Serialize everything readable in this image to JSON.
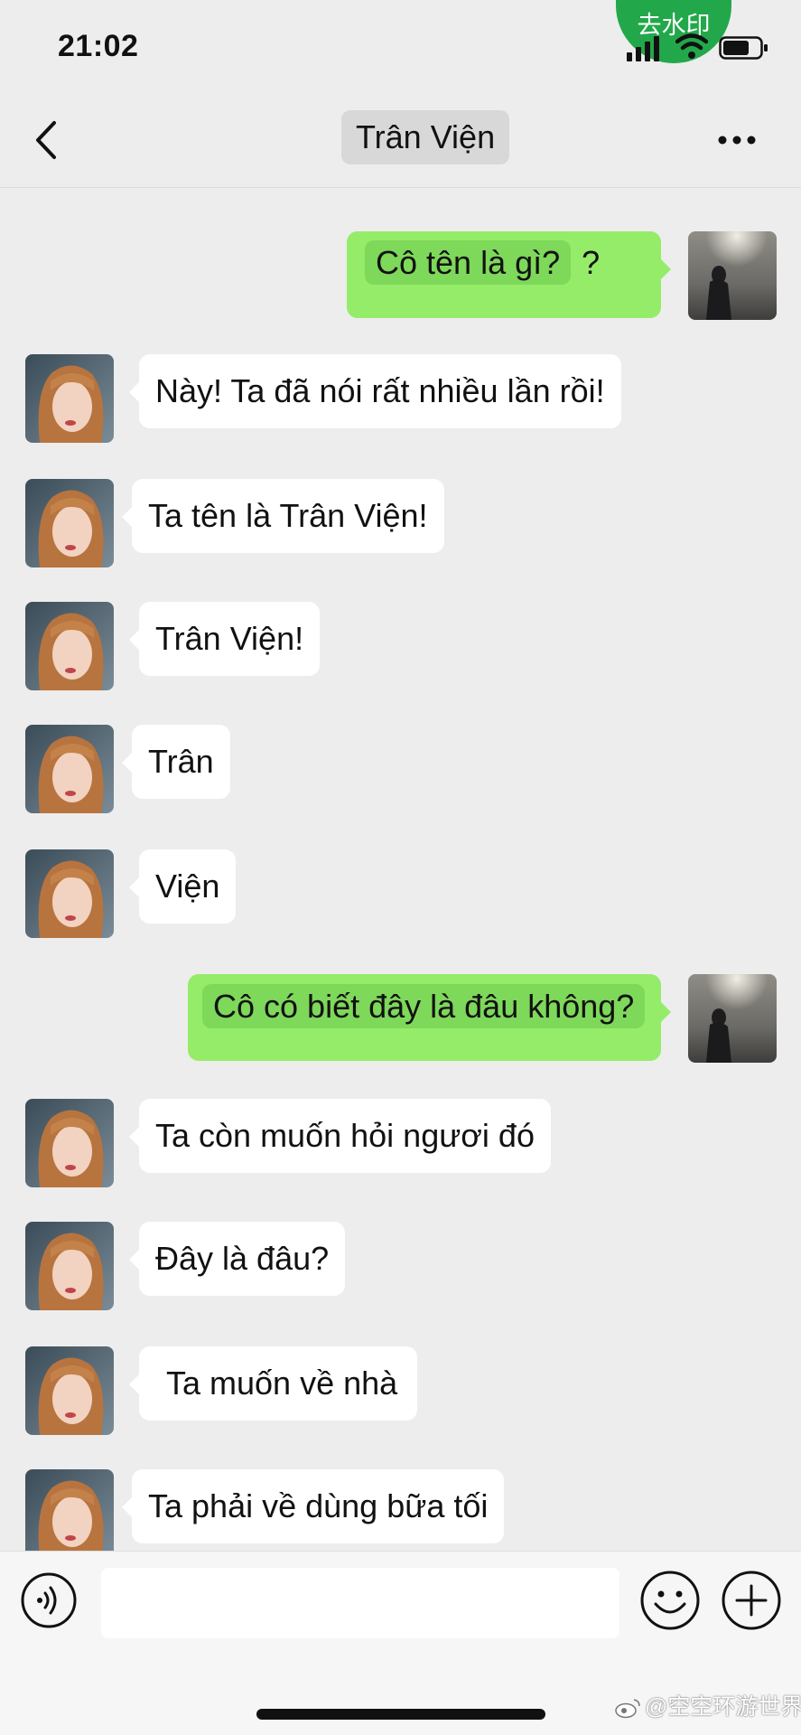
{
  "status_bar": {
    "time": "21:02",
    "watermark_button": "去水印"
  },
  "nav": {
    "title": "Trân Viện",
    "back_icon": "chevron-left-icon",
    "more_icon": "more-dots-icon"
  },
  "messages": [
    {
      "side": "out",
      "text": "Cô tên là gì?",
      "suffix": "?"
    },
    {
      "side": "in",
      "text": "Này! Ta đã nói rất nhiều lần rồi!"
    },
    {
      "side": "in",
      "text": "Ta tên là Trân Viện!"
    },
    {
      "side": "in",
      "text": "Trân Viện!"
    },
    {
      "side": "in",
      "text": "Trân"
    },
    {
      "side": "in",
      "text": "Viện"
    },
    {
      "side": "out",
      "text": "Cô có biết đây là đâu không?"
    },
    {
      "side": "in",
      "text": "Ta còn muốn hỏi ngươi đó"
    },
    {
      "side": "in",
      "text": "Đây là đâu?"
    },
    {
      "side": "in",
      "text": "Ta muốn về nhà"
    },
    {
      "side": "in",
      "text": "Ta phải về dùng bữa tối"
    }
  ],
  "input_bar": {
    "value": "",
    "voice_icon": "voice-icon",
    "emoji_icon": "emoji-icon",
    "plus_icon": "plus-circle-icon"
  },
  "footer": {
    "credit": "@空空环游世界"
  },
  "colors": {
    "background": "#EDEDED",
    "outgoing_bubble": "#95EC69",
    "incoming_bubble": "#FFFFFF",
    "watermark_button": "#22A84A"
  }
}
